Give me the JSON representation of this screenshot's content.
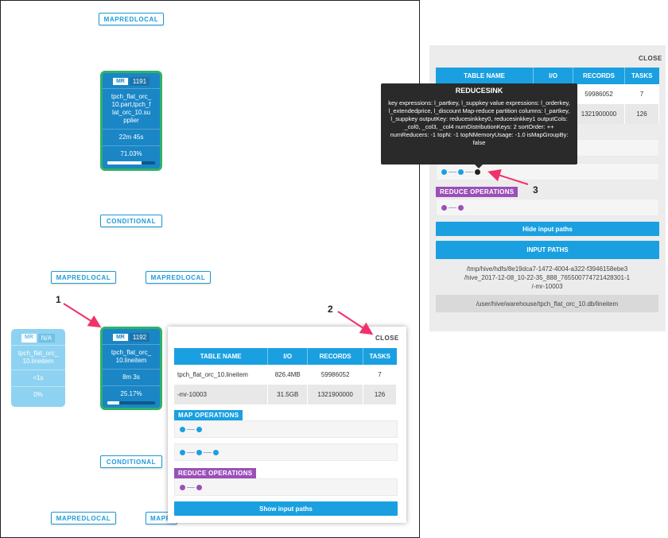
{
  "dag": {
    "top_mapredlocal": "MAPREDLOCAL",
    "node1191": {
      "badge": "MR",
      "id": "1191",
      "name": "tpch_flat_orc_\n10.part,tpch_f\nlat_orc_10.su\npplier",
      "time": "22m 45s",
      "progress": "71.03%",
      "progress_fraction": 0.71
    },
    "conditional_top": "CONDITIONAL",
    "mapredlocal_left": "MAPREDLOCAL",
    "mapredlocal_right": "MAPREDLOCAL",
    "node_na": {
      "badge": "MR",
      "id": "N/A",
      "name": "tpch_flat_orc_\n10.lineitem",
      "time": "<1s",
      "progress": "0%"
    },
    "node1192": {
      "badge": "MR",
      "id": "1192",
      "name": "tpch_flat_orc_\n10.lineitem",
      "time": "8m 3s",
      "progress": "25.17%",
      "progress_fraction": 0.25
    },
    "conditional_bottom": "CONDITIONAL",
    "mapredlocal_bottom_left": "MAPREDLOCAL",
    "mapredlocal_bottom_right": "MAPR"
  },
  "callouts": {
    "one": "1",
    "two": "2",
    "three": "3"
  },
  "popup": {
    "close": "CLOSE",
    "columns": [
      "TABLE NAME",
      "I/O",
      "RECORDS",
      "TASKS"
    ],
    "rows": [
      {
        "name": "tpch_flat_orc_10.lineitem",
        "io": "826.4MB",
        "records": "59986052",
        "tasks": "7"
      },
      {
        "name": "-mr-10003",
        "io": "31.5GB",
        "records": "1321900000",
        "tasks": "126"
      }
    ],
    "map_ops": "MAP OPERATIONS",
    "reduce_ops": "REDUCE OPERATIONS",
    "show_paths": "Show input paths"
  },
  "panel": {
    "close": "CLOSE",
    "columns": [
      "TABLE NAME",
      "I/O",
      "RECORDS",
      "TASKS"
    ],
    "rows": [
      {
        "records": "59986052",
        "tasks": "7"
      },
      {
        "records": "1321900000",
        "tasks": "126"
      }
    ],
    "reduce_ops": "REDUCE OPERATIONS",
    "hide_paths": "Hide input paths",
    "input_paths_title": "INPUT PATHS",
    "path1": "/tmp/hive/hdfs/8e19dca7-1472-4004-a322-f3946158ebe3\n/hive_2017-12-08_10-22-35_888_765500774721428301-1\n/-mr-10003",
    "path2": "/user/hive/warehouse/tpch_flat_orc_10.db/lineitem"
  },
  "tooltip": {
    "title": "REDUCESINK",
    "body": "key expressions: l_partkey, l_suppkey value expressions: l_orderkey, l_extendedprice, l_discount Map-reduce partition columns: l_partkey, l_suppkey outputKey: reducesinkkey0, reducesinkkey1 outputCols: _col0, _col3, _col4 numDistributionKeys: 2 sortOrder: ++ numReducers: -1 topN: -1 topNMemoryUsage: -1.0 isMapGroupBy: false"
  }
}
